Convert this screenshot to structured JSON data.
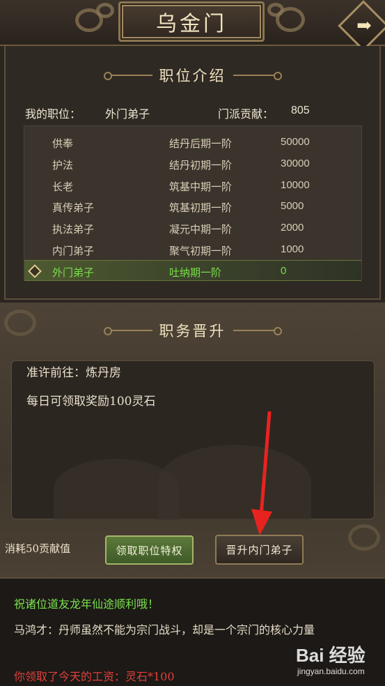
{
  "header": {
    "title": "乌金门",
    "back_icon": "arrow-right-icon",
    "back_glyph": "➡"
  },
  "position_section": {
    "heading": "职位介绍",
    "my_position_label": "我的职位：",
    "my_position_value": "外门弟子",
    "contribution_label": "门派贡献：",
    "contribution_value": "805",
    "ranks": [
      {
        "name": "供奉",
        "requirement": "结丹后期一阶",
        "value": "50000"
      },
      {
        "name": "护法",
        "requirement": "结丹初期一阶",
        "value": "30000"
      },
      {
        "name": "长老",
        "requirement": "筑基中期一阶",
        "value": "10000"
      },
      {
        "name": "真传弟子",
        "requirement": "筑基初期一阶",
        "value": "5000"
      },
      {
        "name": "执法弟子",
        "requirement": "凝元中期一阶",
        "value": "2000"
      },
      {
        "name": "内门弟子",
        "requirement": "聚气初期一阶",
        "value": "1000"
      },
      {
        "name": "外门弟子",
        "requirement": "吐纳期一阶",
        "value": "0"
      }
    ],
    "current_rank_index": 6
  },
  "promotion_section": {
    "heading": "职务晋升",
    "destination": "准许前往：炼丹房",
    "daily_reward": "每日可领取奖励100灵石",
    "cost_text": "消耗50贡献值",
    "claim_button": "领取职位特权",
    "promote_button": "晋升内门弟子"
  },
  "chat": {
    "line1": "祝诸位道友龙年仙途顺利哦！",
    "line2": "马鸿才：丹师虽然不能为宗门战斗，却是一个宗门的核心力量",
    "line3": "你领取了今天的工资：灵石*100"
  },
  "watermark": {
    "main": "Bai 经验",
    "sub": "jingyan.baidu.com"
  },
  "colors": {
    "current_rank_text": "#79e04a",
    "chat_system": "#7be14f",
    "chat_reward": "#e0403a",
    "annotation_arrow": "#e8231f"
  }
}
